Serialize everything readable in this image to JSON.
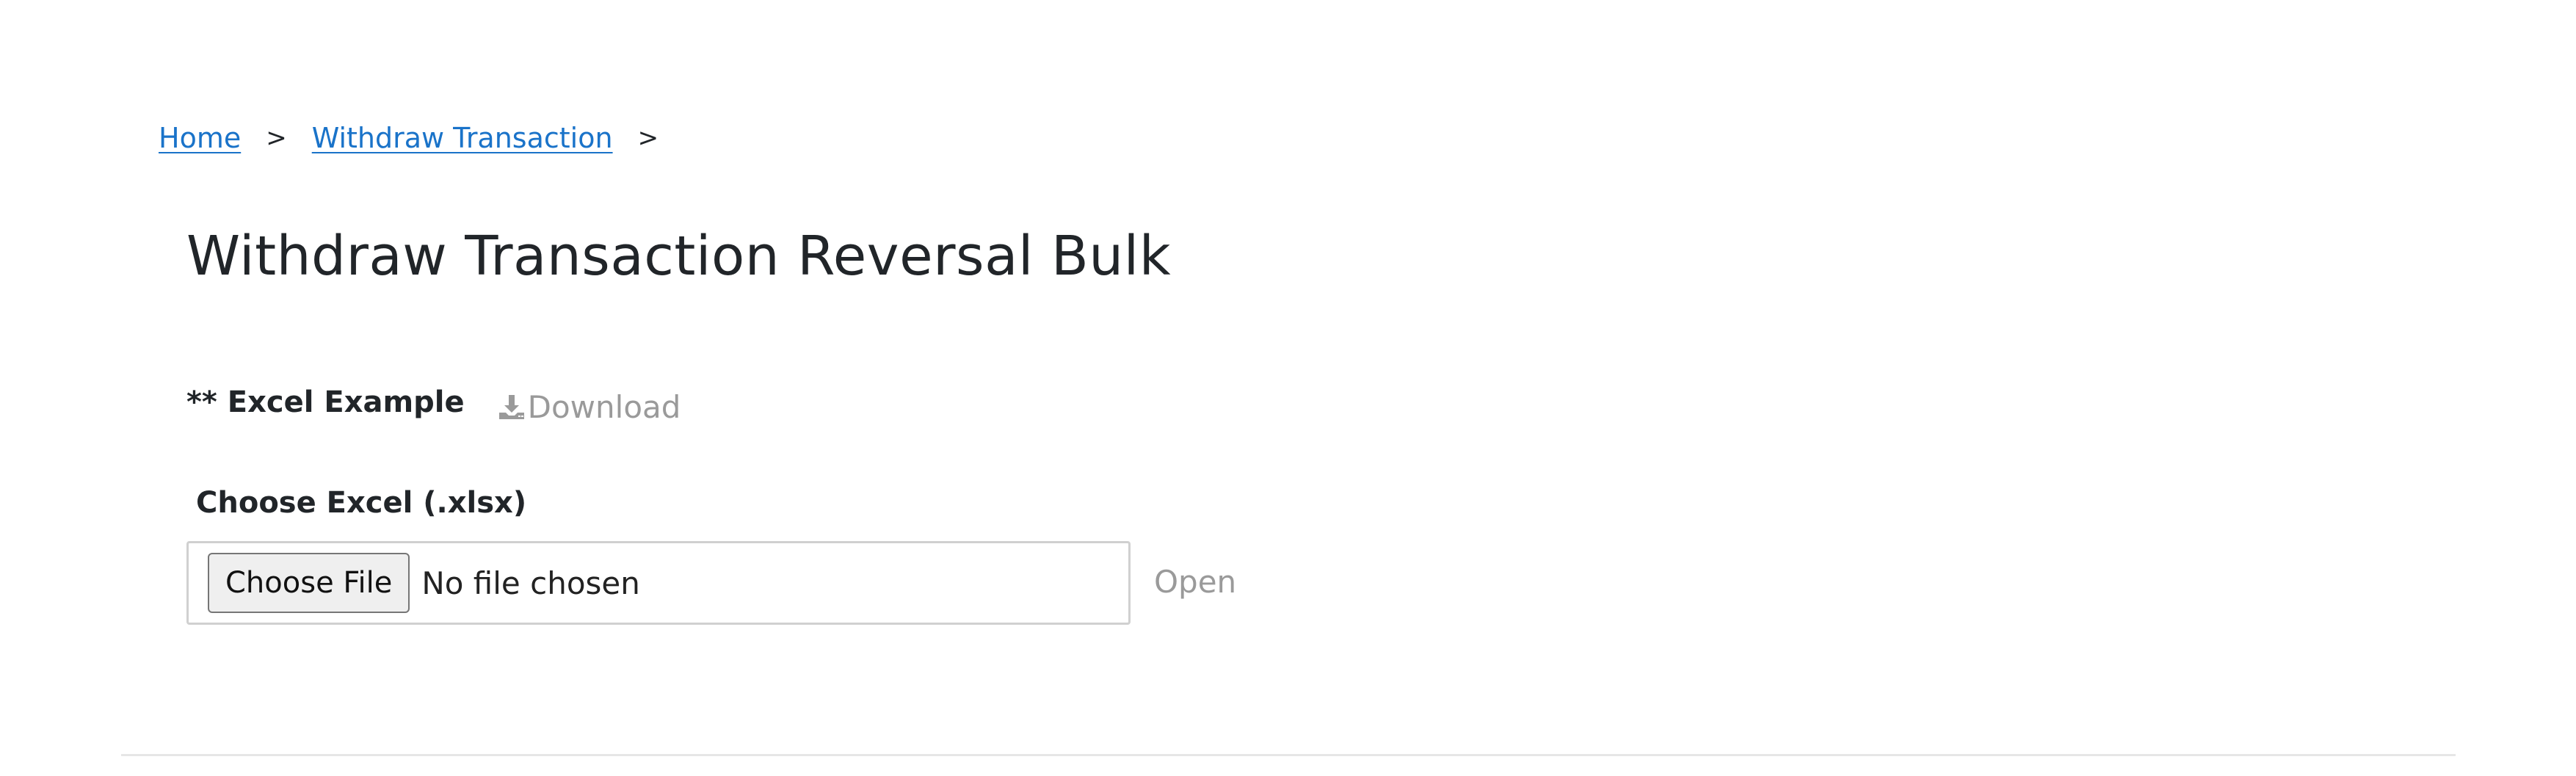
{
  "breadcrumb": {
    "items": [
      {
        "label": "Home"
      },
      {
        "label": "Withdraw Transaction"
      }
    ],
    "separator": ">"
  },
  "page": {
    "title": "Withdraw Transaction Reversal Bulk"
  },
  "excel_example": {
    "label": "** Excel Example",
    "download_label": "Download",
    "download_icon": "download-icon"
  },
  "upload": {
    "label": "Choose Excel (.xlsx)",
    "choose_file_label": "Choose File",
    "no_file_text": "No file chosen",
    "open_label": "Open"
  },
  "colors": {
    "link": "#1a73c9",
    "muted": "#9a9a9a",
    "text": "#212529"
  }
}
